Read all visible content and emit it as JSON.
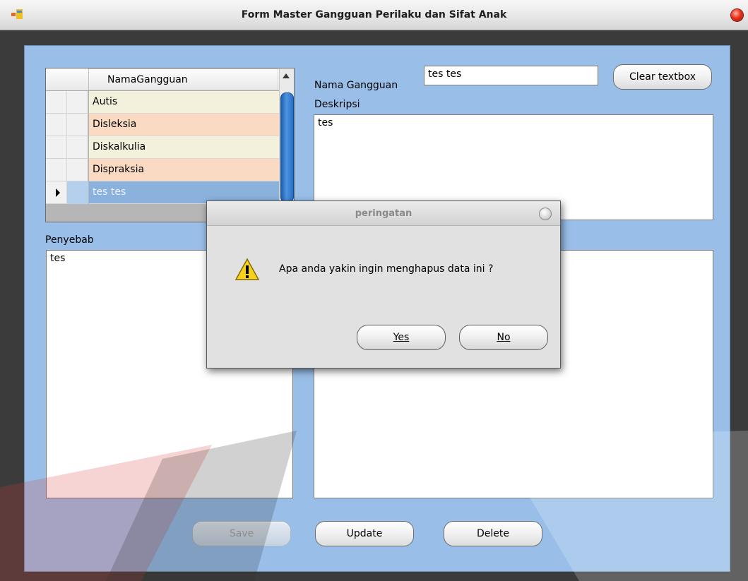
{
  "window": {
    "title": "Form Master Gangguan Perilaku dan Sifat Anak"
  },
  "grid": {
    "column_header": "NamaGangguan",
    "rows": [
      {
        "name": "Autis"
      },
      {
        "name": "Disleksia"
      },
      {
        "name": "Diskalkulia"
      },
      {
        "name": "Dispraksia"
      },
      {
        "name": "tes tes",
        "selected": true
      }
    ]
  },
  "form": {
    "nama_gangguan_label": "Nama Gangguan",
    "nama_gangguan_value": "tes tes",
    "clear_button": "Clear textbox",
    "deskripsi_label": "Deskripsi",
    "deskripsi_value": "tes",
    "penyebab_label": "Penyebab",
    "penyebab_value": "tes"
  },
  "buttons": {
    "save": "Save",
    "update": "Update",
    "delete": "Delete"
  },
  "dialog": {
    "title": "peringatan",
    "message": "Apa anda yakin ingin menghapus data ini ?",
    "yes": "Yes",
    "no": "No",
    "icon": "warning-icon"
  },
  "colors": {
    "client_bg": "#99bfe9",
    "row_odd": "#f3f1dc",
    "row_even": "#fadac2",
    "row_selected": "#8ab2dc"
  }
}
